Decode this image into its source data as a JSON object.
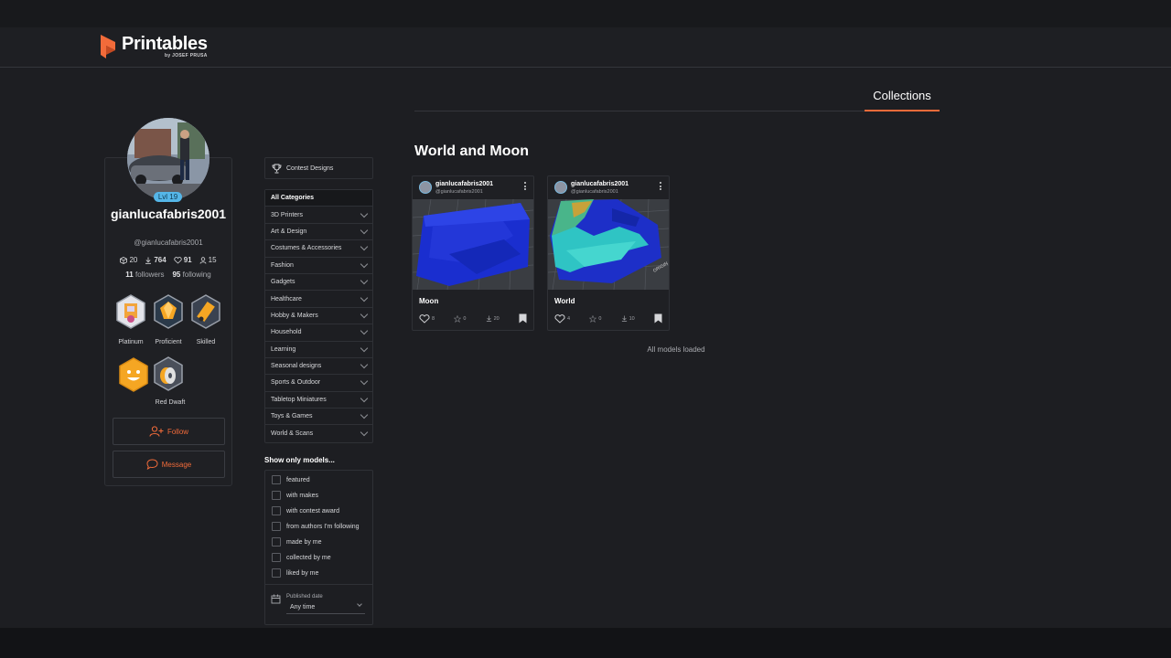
{
  "app": {
    "logo_title": "Printables",
    "logo_subtitle": "by JOSEF PRUSA",
    "accent_color": "#f26b3a"
  },
  "profile": {
    "level": "Lvl 19",
    "username": "gianlucafabris2001",
    "handle": "@gianlucafabris2001",
    "stats": {
      "models": "20",
      "downloads": "764",
      "likes": "91",
      "followers_icon_count": "15"
    },
    "followers": "11",
    "followers_label": "followers",
    "following": "95",
    "following_label": "following",
    "badges": [
      {
        "label": "Platinum",
        "icon": "printer-badge-icon"
      },
      {
        "label": "Proficient",
        "icon": "gem-badge-icon"
      },
      {
        "label": "Skilled",
        "icon": "pencil-badge-icon"
      },
      {
        "label": "",
        "icon": "star-face-badge-icon"
      },
      {
        "label": "Red Dwaft",
        "icon": "filament-spool-badge-icon"
      }
    ],
    "follow_label": "Follow",
    "message_label": "Message"
  },
  "sidebar": {
    "contest_label": "Contest Designs",
    "categories": [
      "All Categories",
      "3D Printers",
      "Art & Design",
      "Costumes & Accessories",
      "Fashion",
      "Gadgets",
      "Healthcare",
      "Hobby & Makers",
      "Household",
      "Learning",
      "Seasonal designs",
      "Sports & Outdoor",
      "Tabletop Miniatures",
      "Toys & Games",
      "World & Scans"
    ],
    "show_only_title": "Show only models...",
    "filters": [
      "featured",
      "with makes",
      "with contest award",
      "from authors I'm following",
      "made by me",
      "collected by me",
      "liked by me"
    ],
    "published_label": "Published date",
    "published_value": "Any time"
  },
  "main": {
    "tab_label": "Collections",
    "collection_title": "World and Moon",
    "cards": [
      {
        "user": "gianlucafabris2001",
        "handle": "@gianlucafabris2001",
        "title": "Moon",
        "likes": "8",
        "rating": "0",
        "downloads": "20"
      },
      {
        "user": "gianlucafabris2001",
        "handle": "@gianlucafabris2001",
        "title": "World",
        "likes": "4",
        "rating": "0",
        "downloads": "10"
      }
    ],
    "all_loaded": "All models loaded"
  }
}
